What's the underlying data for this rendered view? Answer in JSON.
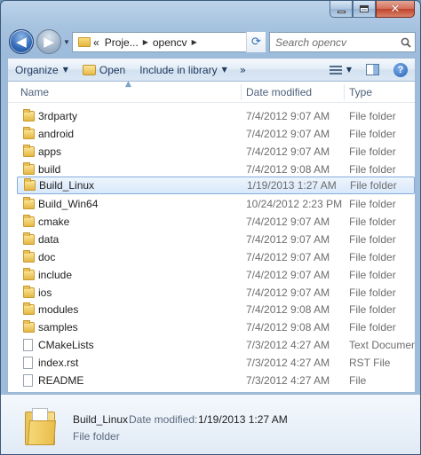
{
  "window": {
    "controls": {
      "minimize": "minimize",
      "maximize": "maximize",
      "close": "close"
    }
  },
  "address": {
    "overflow": "«",
    "segments": [
      "Proje...",
      "opencv"
    ]
  },
  "search": {
    "placeholder": "Search opencv"
  },
  "toolbar": {
    "organize": "Organize",
    "open": "Open",
    "include_in_library": "Include in library",
    "more": "»"
  },
  "columns": {
    "name": "Name",
    "date_modified": "Date modified",
    "type": "Type"
  },
  "files": [
    {
      "name": "3rdparty",
      "date": "7/4/2012 9:07 AM",
      "type": "File folder",
      "kind": "folder"
    },
    {
      "name": "android",
      "date": "7/4/2012 9:07 AM",
      "type": "File folder",
      "kind": "folder"
    },
    {
      "name": "apps",
      "date": "7/4/2012 9:07 AM",
      "type": "File folder",
      "kind": "folder"
    },
    {
      "name": "build",
      "date": "7/4/2012 9:08 AM",
      "type": "File folder",
      "kind": "folder"
    },
    {
      "name": "Build_Linux",
      "date": "1/19/2013 1:27 AM",
      "type": "File folder",
      "kind": "folder",
      "selected": true
    },
    {
      "name": "Build_Win64",
      "date": "10/24/2012 2:23 PM",
      "type": "File folder",
      "kind": "folder"
    },
    {
      "name": "cmake",
      "date": "7/4/2012 9:07 AM",
      "type": "File folder",
      "kind": "folder"
    },
    {
      "name": "data",
      "date": "7/4/2012 9:07 AM",
      "type": "File folder",
      "kind": "folder"
    },
    {
      "name": "doc",
      "date": "7/4/2012 9:07 AM",
      "type": "File folder",
      "kind": "folder"
    },
    {
      "name": "include",
      "date": "7/4/2012 9:07 AM",
      "type": "File folder",
      "kind": "folder"
    },
    {
      "name": "ios",
      "date": "7/4/2012 9:07 AM",
      "type": "File folder",
      "kind": "folder"
    },
    {
      "name": "modules",
      "date": "7/4/2012 9:08 AM",
      "type": "File folder",
      "kind": "folder"
    },
    {
      "name": "samples",
      "date": "7/4/2012 9:08 AM",
      "type": "File folder",
      "kind": "folder"
    },
    {
      "name": "CMakeLists",
      "date": "7/3/2012 4:27 AM",
      "type": "Text Document",
      "kind": "file"
    },
    {
      "name": "index.rst",
      "date": "7/3/2012 4:27 AM",
      "type": "RST File",
      "kind": "file"
    },
    {
      "name": "README",
      "date": "7/3/2012 4:27 AM",
      "type": "File",
      "kind": "file"
    }
  ],
  "details": {
    "name": "Build_Linux",
    "date_label": "Date modified:",
    "date": "1/19/2013 1:27 AM",
    "type": "File folder"
  },
  "colors": {
    "selection_border": "#84acdd",
    "chrome": "#9dbbdb"
  }
}
